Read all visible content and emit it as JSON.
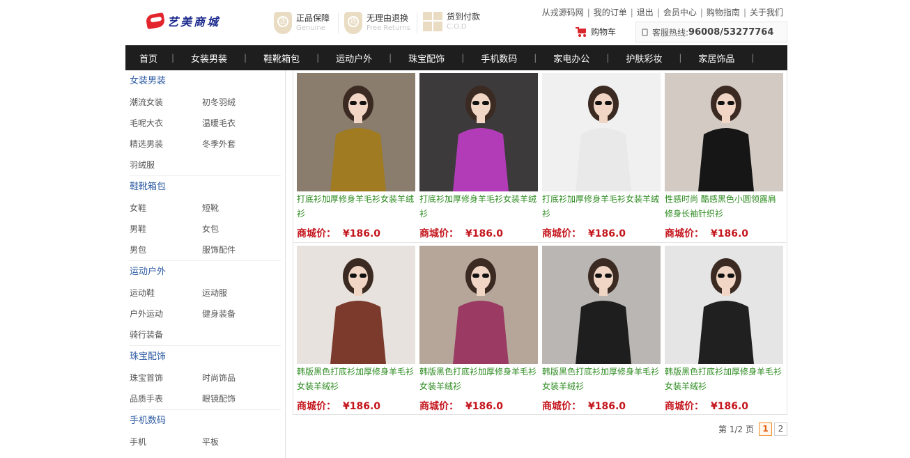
{
  "logo": {
    "name": "艺美商城"
  },
  "promises": [
    {
      "title": "正品保障",
      "sub": "Genuine",
      "icon": "genuine-shield-icon",
      "glyph": "正"
    },
    {
      "title": "无理由退换",
      "sub": "Free Returns",
      "icon": "returns-shield-icon",
      "glyph": "退"
    },
    {
      "title": "货到付款",
      "sub": "C.O.D",
      "icon": "cod-box-icon",
      "glyph": ""
    }
  ],
  "toplinks": [
    "从戎源码网",
    "我的订单",
    "退出",
    "会员中心",
    "购物指南",
    "关于我们"
  ],
  "cart": {
    "label": "购物车"
  },
  "hotline": {
    "label": "客服热线:",
    "number": "96008/53277764"
  },
  "nav": [
    "首页",
    "女装男装",
    "鞋靴箱包",
    "运动户外",
    "珠宝配饰",
    "手机数码",
    "家电办公",
    "护肤彩妆",
    "家居饰品"
  ],
  "categories": [
    {
      "title": "女装男装",
      "items": [
        "潮流女装",
        "初冬羽绒",
        "毛呢大衣",
        "温暖毛衣",
        "精选男装",
        "冬季外套",
        "羽绒服"
      ]
    },
    {
      "title": "鞋靴箱包",
      "items": [
        "女鞋",
        "短靴",
        "男鞋",
        "女包",
        "男包",
        "服饰配件"
      ]
    },
    {
      "title": "运动户外",
      "items": [
        "运动鞋",
        "运动服",
        "户外运动",
        "健身装备",
        "骑行装备"
      ]
    },
    {
      "title": "珠宝配饰",
      "items": [
        "珠宝首饰",
        "时尚饰品",
        "品质手表",
        "眼镜配饰"
      ]
    },
    {
      "title": "手机数码",
      "items": [
        "手机",
        "平板"
      ]
    }
  ],
  "products": [
    {
      "name": "打底衫加厚修身羊毛衫女装羊绒衫",
      "price_label": "商城价：",
      "price": "¥186.0",
      "bg": "#8a7d6d",
      "outfit": "#a07b22"
    },
    {
      "name": "打底衫加厚修身羊毛衫女装羊绒衫",
      "price_label": "商城价：",
      "price": "¥186.0",
      "bg": "#3d3a3c",
      "outfit": "#b23cb8"
    },
    {
      "name": "打底衫加厚修身羊毛衫女装羊绒衫",
      "price_label": "商城价：",
      "price": "¥186.0",
      "bg": "#f1f0f1",
      "outfit": "#e9e9e9"
    },
    {
      "name": "性感时尚 酷感黑色小圆领露肩修身长袖针织衫",
      "price_label": "商城价：",
      "price": "¥186.0",
      "bg": "#d3cbc3",
      "outfit": "#161616"
    },
    {
      "name": "韩版黑色打底衫加厚修身羊毛衫女装羊绒衫",
      "price_label": "商城价：",
      "price": "¥186.0",
      "bg": "#e7e2dd",
      "outfit": "#7b3a2c"
    },
    {
      "name": "韩版黑色打底衫加厚修身羊毛衫女装羊绒衫",
      "price_label": "商城价：",
      "price": "¥186.0",
      "bg": "#b6a69a",
      "outfit": "#9b3a62"
    },
    {
      "name": "韩版黑色打底衫加厚修身羊毛衫女装羊绒衫",
      "price_label": "商城价：",
      "price": "¥186.0",
      "bg": "#b9b6b3",
      "outfit": "#1e1e1e"
    },
    {
      "name": "韩版黑色打底衫加厚修身羊毛衫女装羊绒衫",
      "price_label": "商城价：",
      "price": "¥186.0",
      "bg": "#e5e5e5",
      "outfit": "#202020"
    }
  ],
  "pager": {
    "info": "第 1/2 页",
    "pages": [
      "1",
      "2"
    ],
    "current": "1"
  }
}
